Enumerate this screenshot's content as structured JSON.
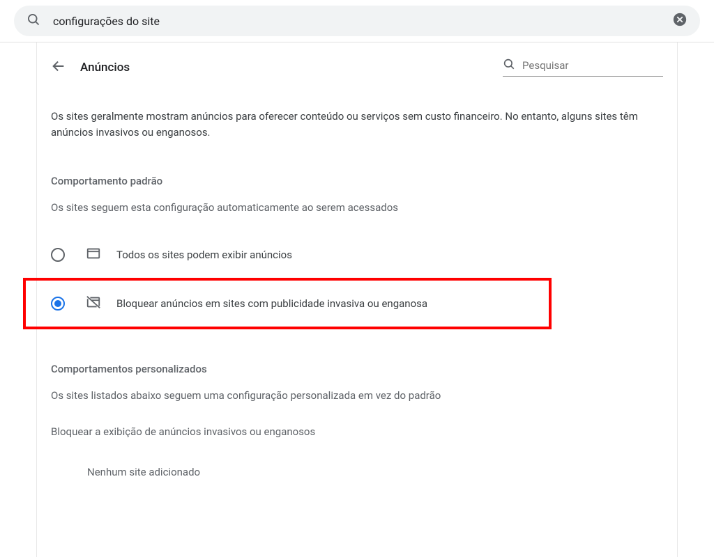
{
  "searchBar": {
    "value": "configurações do site"
  },
  "panel": {
    "title": "Anúncios",
    "searchPlaceholder": "Pesquisar",
    "description": "Os sites geralmente mostram anúncios para oferecer conteúdo ou serviços sem custo financeiro. No entanto, alguns sites têm anúncios invasivos ou enganosos."
  },
  "defaultBehavior": {
    "heading": "Comportamento padrão",
    "sub": "Os sites seguem esta configuração automaticamente ao serem acessados",
    "options": [
      {
        "label": "Todos os sites podem exibir anúncios"
      },
      {
        "label": "Bloquear anúncios em sites com publicidade invasiva ou enganosa"
      }
    ]
  },
  "custom": {
    "heading": "Comportamentos personalizados",
    "sub": "Os sites listados abaixo seguem uma configuração personalizada em vez do padrão",
    "listLabel": "Bloquear a exibição de anúncios invasivos ou enganosos",
    "empty": "Nenhum site adicionado"
  }
}
